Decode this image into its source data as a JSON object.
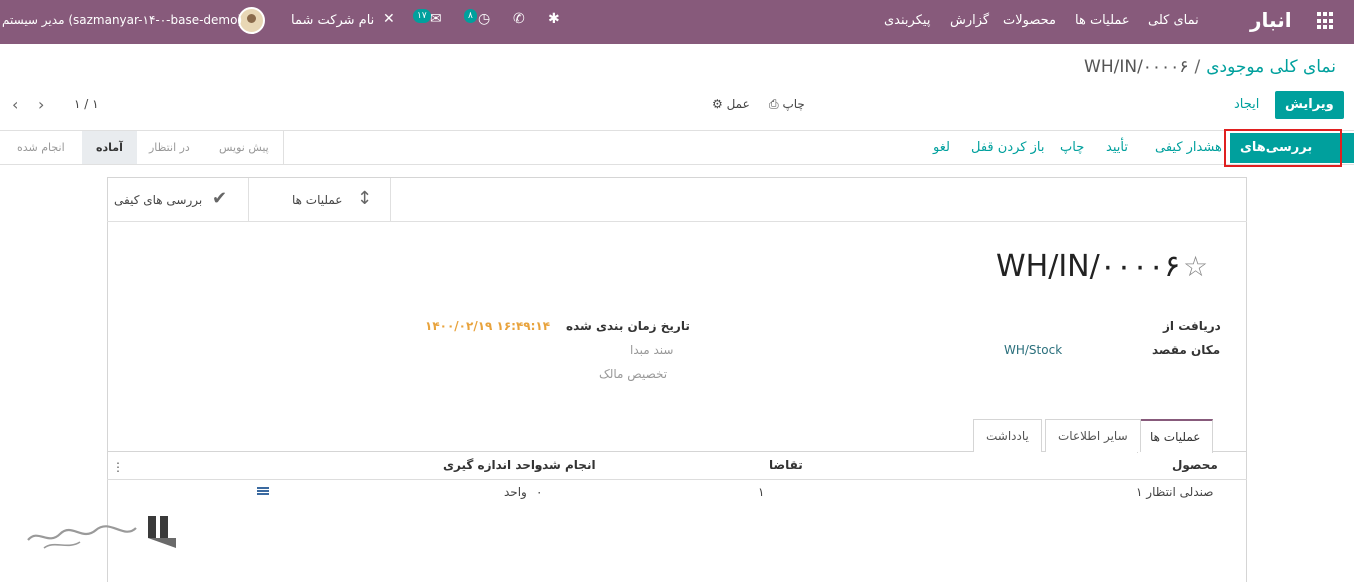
{
  "navbar": {
    "brand": "انبار",
    "menu": [
      "نمای کلی",
      "عملیات ها",
      "محصولات",
      "گزارش",
      "پیکربندی"
    ],
    "company": "نام شرکت شما",
    "user": "مدیر سیستم (sazmanyar-۱۴-۰-base-demo)",
    "badge_activity": "۸",
    "badge_messages": "۱۷"
  },
  "breadcrumb": {
    "parent": "نمای کلی موجودی",
    "separator": "/",
    "current": "WH/IN/۰۰۰۰۶"
  },
  "control_panel": {
    "edit": "ویرایش",
    "create": "ایجاد",
    "print": "چاپ",
    "action": "عمل",
    "pager": "۱ / ۱"
  },
  "statusbar": {
    "buttons": [
      "بررسی‌های کیفی",
      "هشدار کیفی",
      "تأیید",
      "چاپ",
      "باز کردن قفل",
      "لغو"
    ],
    "stages": [
      "پیش نویس",
      "در انتظار",
      "آماده",
      "انجام شده"
    ],
    "active_stage": "آماده"
  },
  "smart_buttons": {
    "operations": "عملیات ها",
    "quality_checks": "بررسی های کیفی"
  },
  "record": {
    "title": "WH/IN/۰۰۰۰۶",
    "receive_from_label": "دریافت از",
    "destination_label": "مکان مقصد",
    "destination_value": "WH/Stock",
    "scheduled_date_label": "تاریخ زمان بندی شده",
    "scheduled_date_value": "۱۴۰۰/۰۲/۱۹ ۱۶:۴۹:۱۴",
    "source_doc_label": "سند مبدا",
    "owner_label": "تخصیص مالک"
  },
  "tabs": [
    "عملیات ها",
    "سایر اطلاعات",
    "یادداشت"
  ],
  "table": {
    "headers": [
      "محصول",
      "تقاضا",
      "انجام شده",
      "واحد اندازه گیری"
    ],
    "rows": [
      {
        "product": "صندلی انتظار ۱",
        "demand": "۱",
        "done": "۰",
        "uom": "واحد"
      }
    ]
  },
  "colors": {
    "navbar": "#875a7b",
    "primary": "#00a09d",
    "date": "#e8a33d",
    "highlight": "#e02020"
  }
}
